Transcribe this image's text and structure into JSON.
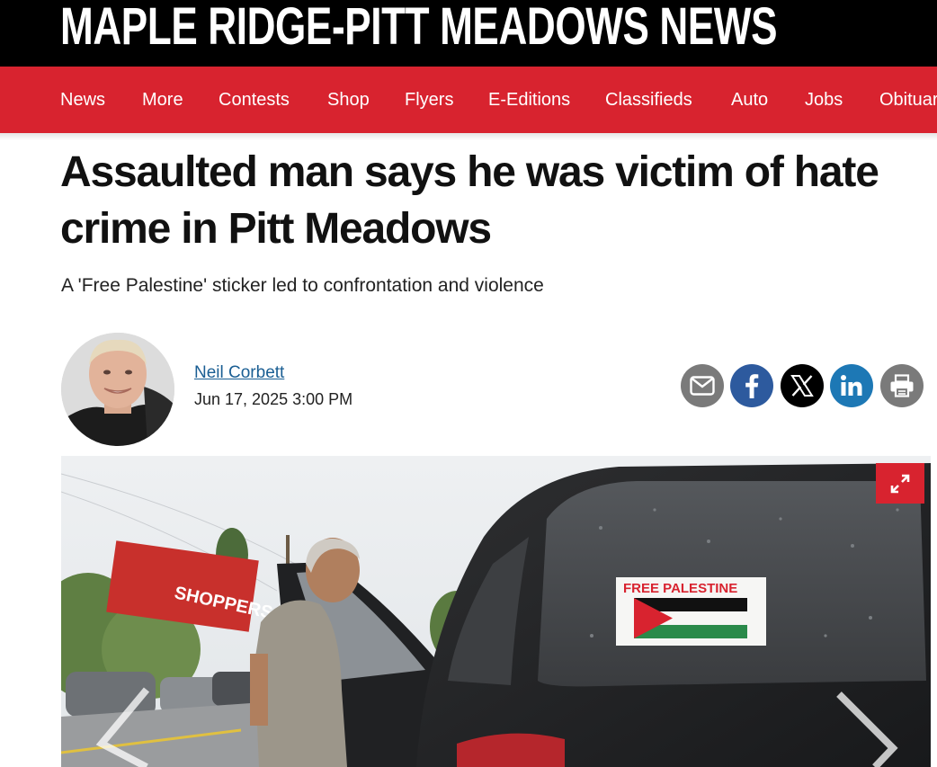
{
  "masthead": {
    "title": "MAPLE RIDGE-PITT MEADOWS NEWS"
  },
  "nav": {
    "items": [
      "News",
      "More",
      "Contests",
      "Shop",
      "Flyers",
      "E-Editions",
      "Classifieds",
      "Auto",
      "Jobs",
      "Obituaries"
    ]
  },
  "article": {
    "headline": "Assaulted man says he was victim of hate crime in Pitt Meadows",
    "subhead": "A 'Free Palestine' sticker led to confrontation and violence",
    "author": "Neil Corbett",
    "date": "Jun 17, 2025 3:00 PM"
  },
  "share": {
    "icons": [
      "email-icon",
      "facebook-icon",
      "x-icon",
      "linkedin-icon",
      "print-icon"
    ],
    "colors": {
      "email": "#7a7a7a",
      "facebook": "#2d5a9e",
      "x": "#000000",
      "linkedin": "#1d78b5",
      "print": "#7a7a7a"
    }
  },
  "photo": {
    "sticker_text": "FREE PALESTINE",
    "store_sign": "SHOPPERS"
  },
  "colors": {
    "brand_red": "#d8232f",
    "masthead": "#000000",
    "link": "#1a5e93"
  }
}
